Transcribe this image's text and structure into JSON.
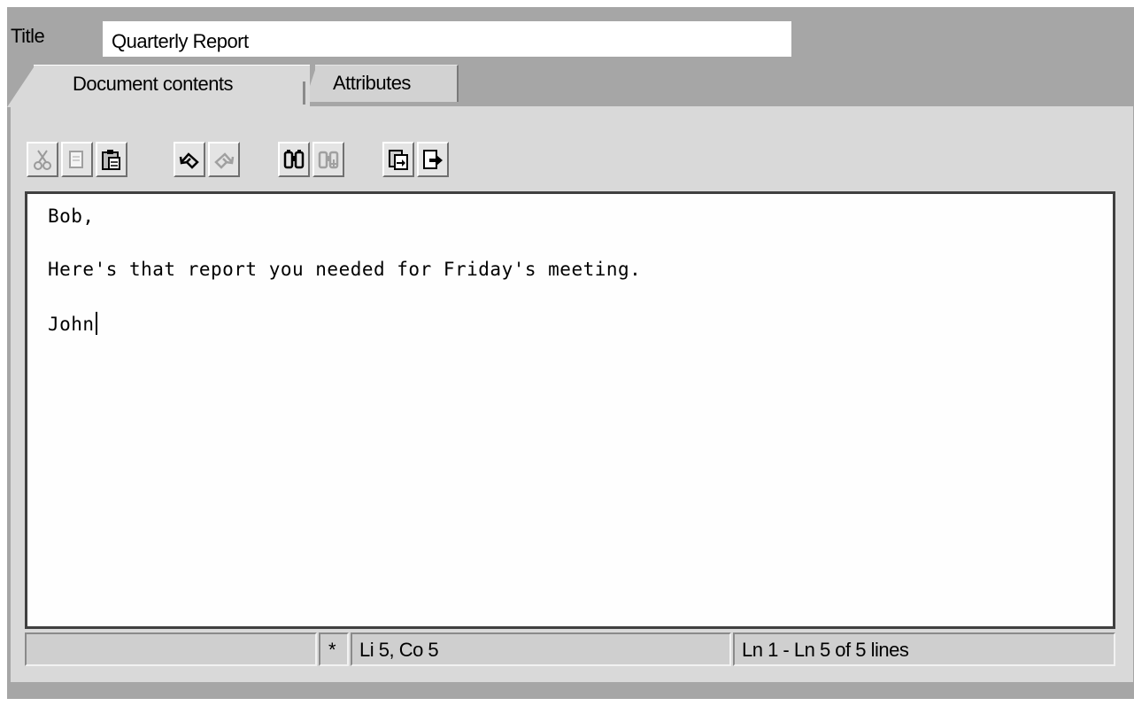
{
  "title_field": {
    "label": "Title",
    "value": "Quarterly Report"
  },
  "tabs": [
    {
      "label": "Document contents",
      "active": true
    },
    {
      "label": "Attributes",
      "active": false
    }
  ],
  "toolbar": {
    "buttons": [
      {
        "icon": "scissors-icon",
        "action": "cut",
        "enabled": false
      },
      {
        "icon": "copy-icon",
        "action": "copy",
        "enabled": false
      },
      {
        "icon": "paste-icon",
        "action": "paste",
        "enabled": true
      },
      {
        "icon": "undo-icon",
        "action": "undo",
        "enabled": true
      },
      {
        "icon": "redo-icon",
        "action": "redo",
        "enabled": false
      },
      {
        "icon": "binoculars-icon",
        "action": "find",
        "enabled": true
      },
      {
        "icon": "binoculars-plus-icon",
        "action": "find-next",
        "enabled": false
      },
      {
        "icon": "import-icon",
        "action": "import",
        "enabled": true
      },
      {
        "icon": "export-icon",
        "action": "export",
        "enabled": true
      }
    ]
  },
  "editor": {
    "lines": [
      "Bob,",
      "",
      "Here's that report you needed for Friday's meeting.",
      "",
      "John"
    ]
  },
  "status_bar": {
    "empty_cell": "",
    "modified_marker": "*",
    "cursor_position": "Li 5, Co 5",
    "line_range": "Ln 1 - Ln 5 of 5 lines"
  },
  "colors": {
    "frame_gray": "#a6a6a6",
    "panel_gray": "#d9d9d9",
    "editor_bg": "#fefefe"
  }
}
